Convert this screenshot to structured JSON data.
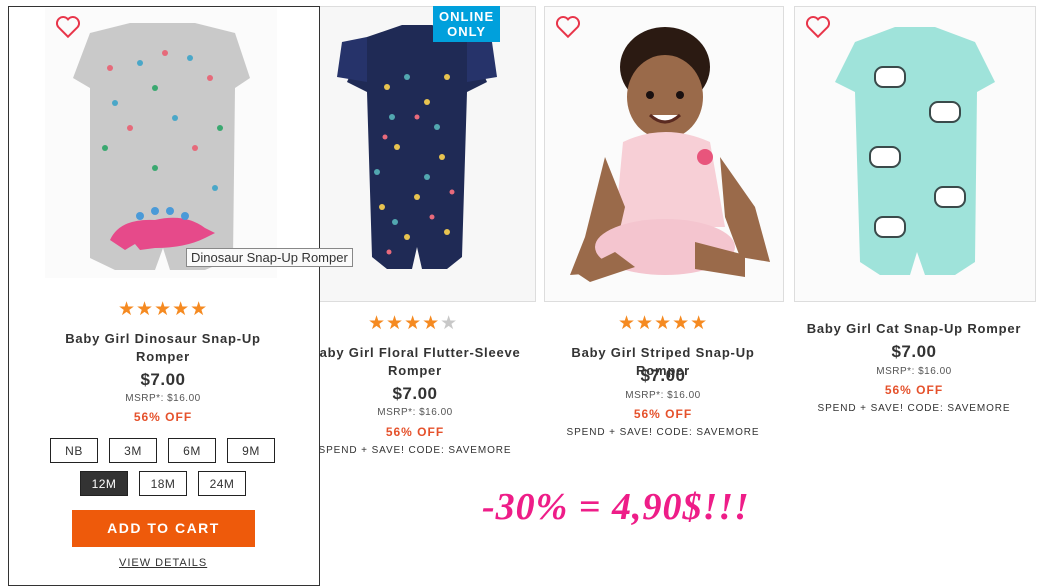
{
  "products": [
    {
      "name": "Baby Girl Dinosaur Snap-Up Romper",
      "name_line1": "Baby Girl Dinosaur Snap-Up",
      "name_line2": "Romper",
      "price": "$7.00",
      "msrp": "MSRP*: $16.00",
      "discount": "56% OFF",
      "rating": 5,
      "tooltip": "Dinosaur Snap-Up Romper",
      "sizes": [
        "NB",
        "3M",
        "6M",
        "9M",
        "12M",
        "18M",
        "24M"
      ],
      "selected_size": "12M",
      "add_to_cart": "ADD TO CART",
      "view_details": "VIEW DETAILS"
    },
    {
      "name_line1": "Baby Girl Floral Flutter-Sleeve",
      "name_line2": "Romper",
      "price": "$7.00",
      "msrp": "MSRP*: $16.00",
      "discount": "56% OFF",
      "promo": "SPEND + SAVE! CODE: SAVEMORE",
      "rating": 4.5,
      "badge": "ONLINE ONLY"
    },
    {
      "name_line1": "Baby Girl Striped Snap-Up Romper",
      "price": "$7.00",
      "msrp": "MSRP*: $16.00",
      "discount": "56% OFF",
      "promo": "SPEND + SAVE! CODE: SAVEMORE",
      "rating": 5
    },
    {
      "name_line1": "Baby Girl Cat Snap-Up Romper",
      "price": "$7.00",
      "msrp": "MSRP*: $16.00",
      "discount": "56% OFF",
      "promo": "SPEND + SAVE! CODE: SAVEMORE"
    }
  ],
  "annotation": "-30% = 4,90$!!!",
  "colors": {
    "accent": "#ee5a0b",
    "star": "#f58a21",
    "discount": "#e5512b",
    "badge": "#00a0dc",
    "annotation": "#ee1d88"
  }
}
